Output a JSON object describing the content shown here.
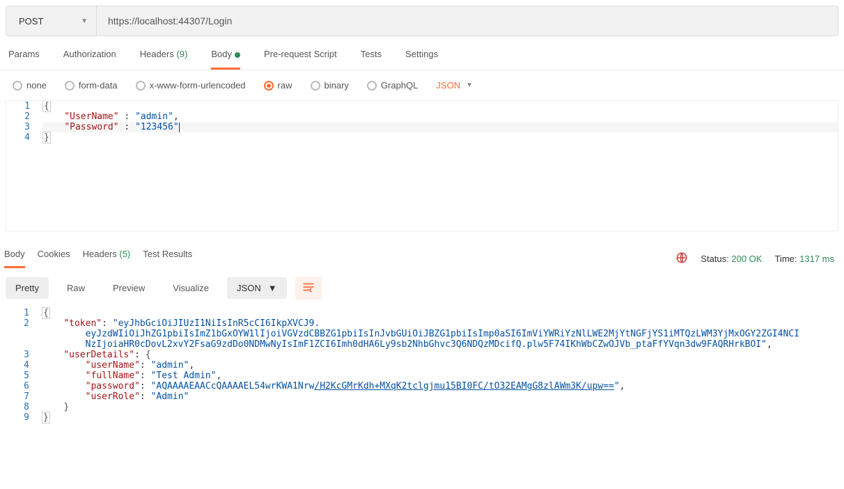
{
  "request": {
    "method": "POST",
    "url": "https://localhost:44307/Login"
  },
  "tabs": {
    "params": "Params",
    "authorization": "Authorization",
    "headers": "Headers",
    "headers_count": "(9)",
    "body": "Body",
    "prerequest": "Pre-request Script",
    "tests": "Tests",
    "settings": "Settings"
  },
  "body_types": {
    "none": "none",
    "form_data": "form-data",
    "xwww": "x-www-form-urlencoded",
    "raw": "raw",
    "binary": "binary",
    "graphql": "GraphQL",
    "format": "JSON"
  },
  "request_body": {
    "line1": "{",
    "line2_key": "\"UserName\"",
    "line2_val": "\"admin\"",
    "line3_key": "\"Password\"",
    "line3_val": "\"123456\"",
    "line4": "}"
  },
  "response_tabs": {
    "body": "Body",
    "cookies": "Cookies",
    "headers": "Headers",
    "headers_count": "(5)",
    "test_results": "Test Results"
  },
  "response_meta": {
    "status_label": "Status:",
    "status_value": "200 OK",
    "time_label": "Time:",
    "time_value": "1317 ms"
  },
  "view_modes": {
    "pretty": "Pretty",
    "raw": "Raw",
    "preview": "Preview",
    "visualize": "Visualize",
    "format": "JSON"
  },
  "response_body": {
    "l1": "{",
    "l2_key": "\"token\"",
    "l2_val_a": "\"eyJhbGciOiJIUzI1NiIsInR5cCI6IkpXVCJ9.",
    "l2_val_b": "eyJzdWIiOiJhZG1pbiIsImZ1bGxOYW1lIjoiVGVzdCBBZG1pbiIsInJvbGUiOiJBZG1pbiIsImp0aSI6ImViYWRiYzNlLWE2MjYtNGFjYS1iMTQzLWM3YjMxOGY2ZGI4NCI",
    "l2_val_c": "NzIjoiaHR0cDovL2xvY2FsaG9zdDo0NDMwNyIsImF1ZCI6Imh0dHA6Ly9sb2NhbGhvc3Q6NDQzMDcifQ.plw5F74IKhWbCZwOJVb_ptaFfYVqn3dw9FAQRHrkBOI\"",
    "l3_key": "\"userDetails\"",
    "l4_key": "\"userName\"",
    "l4_val": "\"admin\"",
    "l5_key": "\"fullName\"",
    "l5_val": "\"Test Admin\"",
    "l6_key": "\"password\"",
    "l6_val_a": "\"AQAAAAEAACcQAAAAEL54wrKWA1Nrw",
    "l6_val_b": "/H2KcGMrKdh+MXqK2tclgjmu15BI0FC/tO32EAMgG8zlAWm3K/upw==",
    "l6_val_c": "\"",
    "l7_key": "\"userRole\"",
    "l7_val": "\"Admin\""
  }
}
